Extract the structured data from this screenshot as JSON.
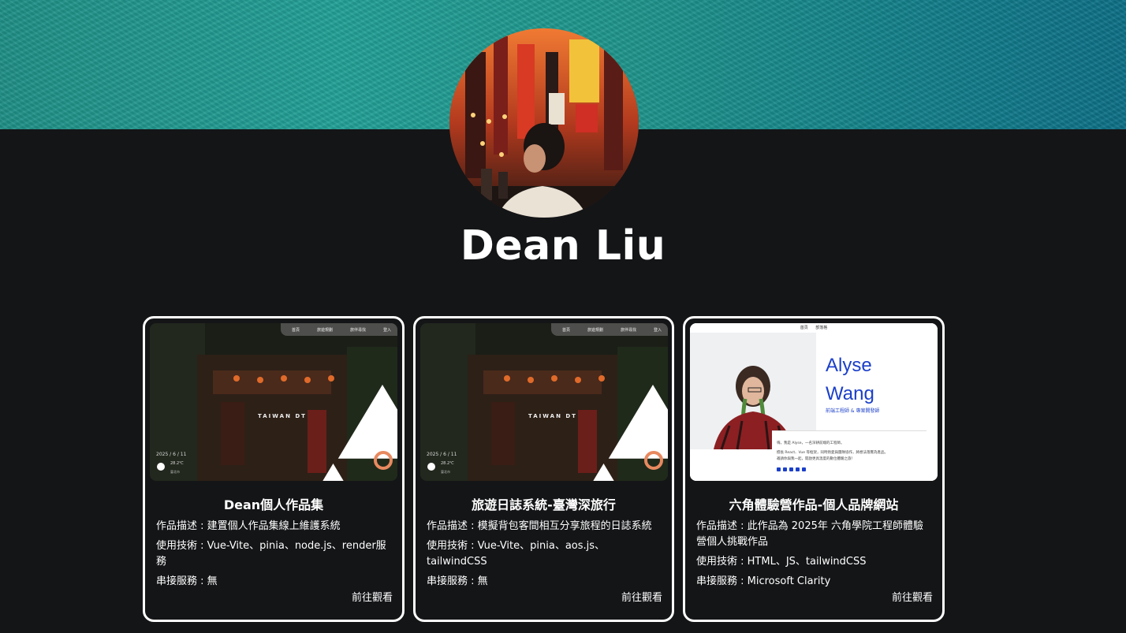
{
  "profile": {
    "name": "Dean Liu"
  },
  "colors": {
    "background": "#141517",
    "card_border": "#ffffff",
    "banner": "#1e958b",
    "accent_blue": "#1a3fc9",
    "ring_orange": "#e8895f"
  },
  "cards": [
    {
      "title": "Dean個人作品集",
      "description": "作品描述 : 建置個人作品集線上維護系統",
      "tech": "使用技術 : Vue-Vite、pinia、node.js、render服務",
      "service": "串接服務 : 無",
      "link": "前往觀看",
      "thumb": {
        "nav": [
          "首頁",
          "旅遊規劃",
          "旅伴尋找",
          "登入"
        ],
        "logo": "TAIWAN DT",
        "date": "2025 / 6 / 11",
        "temp": "28.2℃",
        "city": "臺北市",
        "icon": "sun-icon"
      }
    },
    {
      "title": "旅遊日誌系統-臺灣深旅行",
      "description": "作品描述 : 模擬背包客間相互分享旅程的日誌系統",
      "tech": "使用技術 : Vue-Vite、pinia、aos.js、tailwindCSS",
      "service": "串接服務 : 無",
      "link": "前往觀看",
      "thumb": {
        "nav": [
          "首頁",
          "旅遊規劃",
          "旅伴尋找",
          "登入"
        ],
        "logo": "TAIWAN DT",
        "date": "2025 / 6 / 11",
        "temp": "28.2℃",
        "city": "臺北市",
        "icon": "sun-icon"
      }
    },
    {
      "title": "六角體驗營作品-個人品牌網站",
      "description": "作品描述 : 此作品為 2025年 六角學院工程師體驗營個人挑戰作品",
      "tech": "使用技術 : HTML、JS、tailwindCSS",
      "service": "串接服務 : Microsoft Clarity",
      "link": "前往觀看",
      "thumb": {
        "nav": [
          "首頁",
          "部落格"
        ],
        "name_line1": "Alyse",
        "name_line2": "Wang",
        "subtitle": "前端工程師 & 專案開發師",
        "intro_line1": "嗨，我是 Alyse，一名深耕前端的工程師。",
        "intro_line2": "擅長 React、Vue 等框架，同時熱愛與團隊協作，將想法落實為產品。",
        "intro_line3": "邀請你與我一起，開啟更具溫度的數位體驗之旅！"
      }
    }
  ]
}
